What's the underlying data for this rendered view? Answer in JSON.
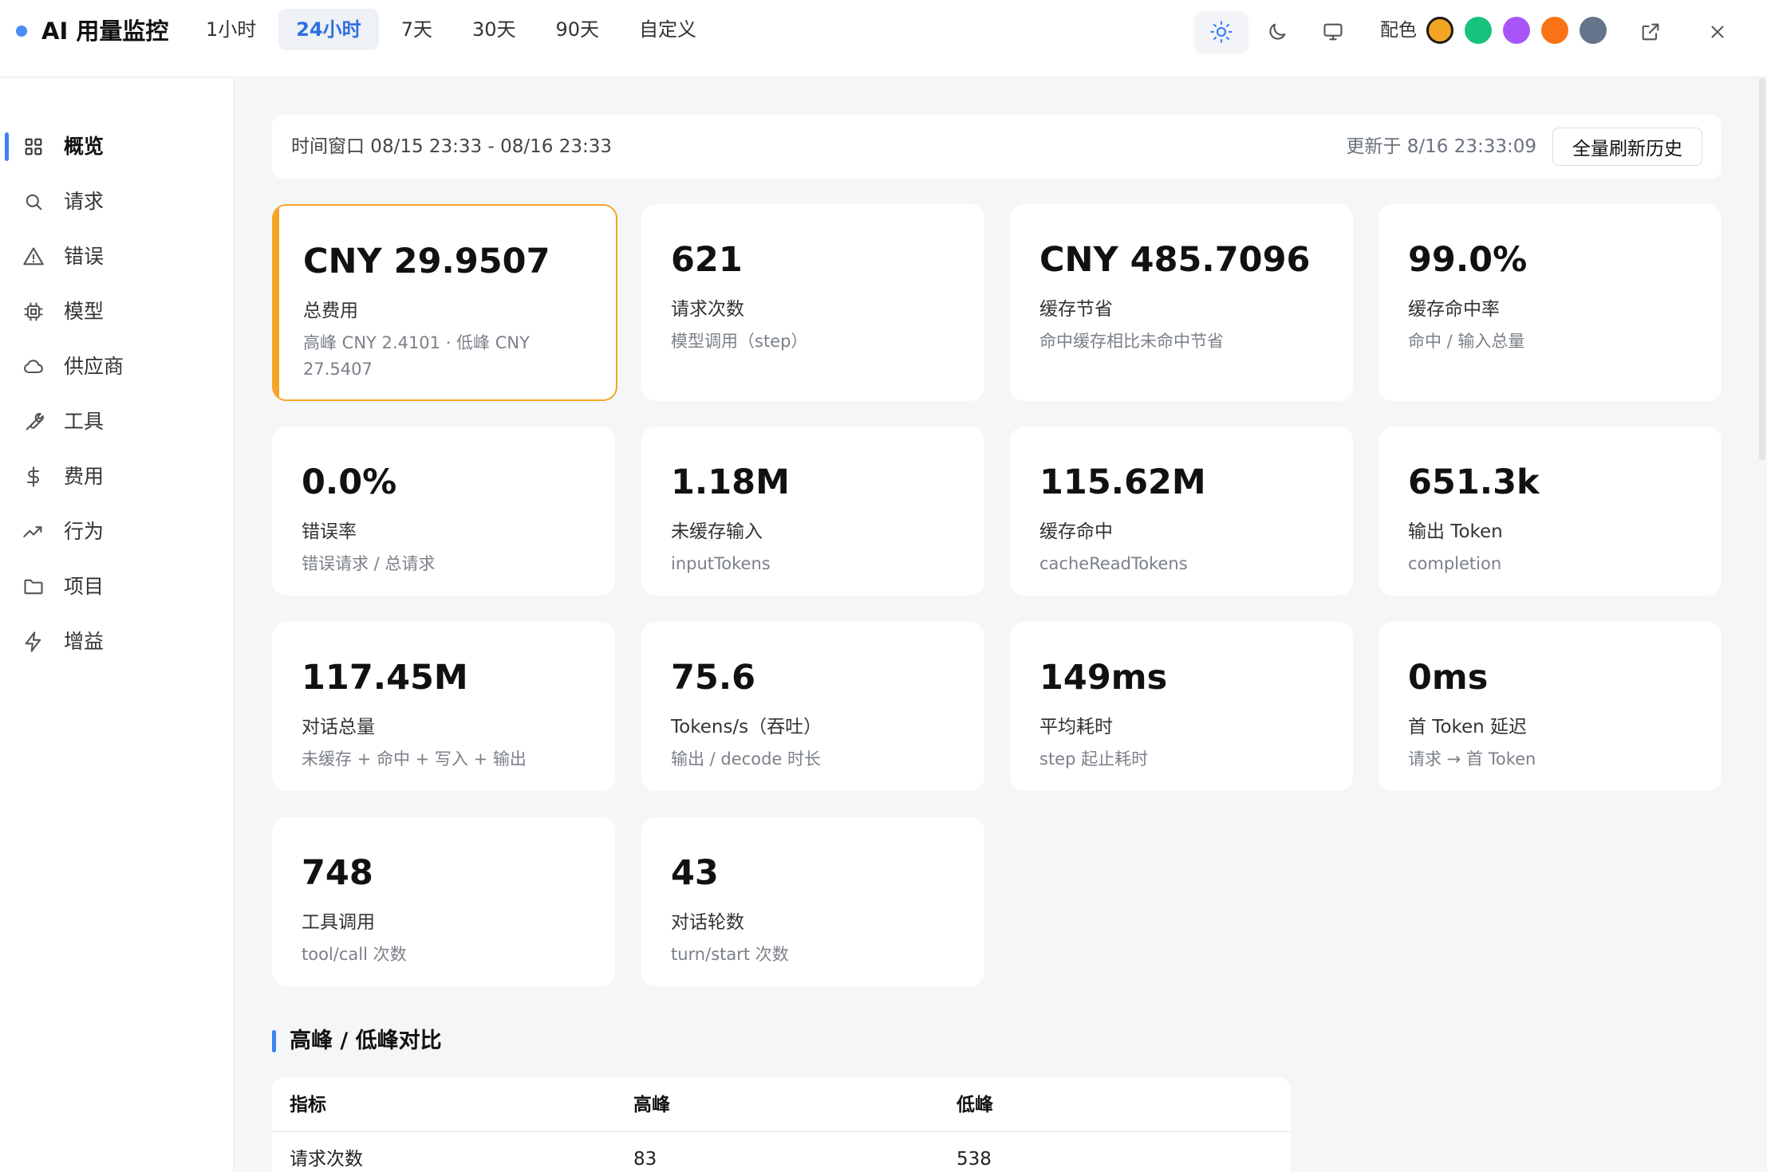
{
  "app": {
    "title": "AI 用量监控"
  },
  "range_tabs": [
    {
      "label": "1小时",
      "active": false
    },
    {
      "label": "24小时",
      "active": true
    },
    {
      "label": "7天",
      "active": false
    },
    {
      "label": "30天",
      "active": false
    },
    {
      "label": "90天",
      "active": false
    },
    {
      "label": "自定义",
      "active": false
    }
  ],
  "toolbar": {
    "theme_icons": [
      "sun-icon",
      "moon-icon",
      "monitor-icon"
    ],
    "palette_label": "配色",
    "palette_colors": [
      "#f5a524",
      "#17c27f",
      "#a855f7",
      "#f97316",
      "#64748b"
    ],
    "selected_palette": 0,
    "open_external_icon": "external-link-icon",
    "close_icon": "close-icon"
  },
  "sidebar": {
    "items": [
      {
        "label": "概览",
        "icon": "grid-icon",
        "active": true
      },
      {
        "label": "请求",
        "icon": "search-icon",
        "active": false
      },
      {
        "label": "错误",
        "icon": "warning-icon",
        "active": false
      },
      {
        "label": "模型",
        "icon": "chip-icon",
        "active": false
      },
      {
        "label": "供应商",
        "icon": "cloud-icon",
        "active": false
      },
      {
        "label": "工具",
        "icon": "wrench-icon",
        "active": false
      },
      {
        "label": "费用",
        "icon": "dollar-icon",
        "active": false
      },
      {
        "label": "行为",
        "icon": "trend-icon",
        "active": false
      },
      {
        "label": "项目",
        "icon": "folder-icon",
        "active": false
      },
      {
        "label": "增益",
        "icon": "bolt-icon",
        "active": false
      }
    ]
  },
  "window_bar": {
    "window_text": "时间窗口 08/15 23:33 - 08/16 23:33",
    "updated_text": "更新于 8/16 23:33:09",
    "refresh_label": "全量刷新历史"
  },
  "cards": [
    {
      "value": "CNY 29.9507",
      "title": "总费用",
      "sub": "高峰 CNY 2.4101 · 低峰 CNY 27.5407",
      "highlight": true
    },
    {
      "value": "621",
      "title": "请求次数",
      "sub": "模型调用（step）"
    },
    {
      "value": "CNY 485.7096",
      "title": "缓存节省",
      "sub": "命中缓存相比未命中节省"
    },
    {
      "value": "99.0%",
      "title": "缓存命中率",
      "sub": "命中 / 输入总量"
    },
    {
      "value": "0.0%",
      "title": "错误率",
      "sub": "错误请求 / 总请求"
    },
    {
      "value": "1.18M",
      "title": "未缓存输入",
      "sub": "inputTokens"
    },
    {
      "value": "115.62M",
      "title": "缓存命中",
      "sub": "cacheReadTokens"
    },
    {
      "value": "651.3k",
      "title": "输出 Token",
      "sub": "completion"
    },
    {
      "value": "117.45M",
      "title": "对话总量",
      "sub": "未缓存 + 命中 + 写入 + 输出"
    },
    {
      "value": "75.6",
      "title": "Tokens/s（吞吐）",
      "sub": "输出 / decode 时长"
    },
    {
      "value": "149ms",
      "title": "平均耗时",
      "sub": "step 起止耗时"
    },
    {
      "value": "0ms",
      "title": "首 Token 延迟",
      "sub": "请求 → 首 Token"
    },
    {
      "value": "748",
      "title": "工具调用",
      "sub": "tool/call 次数"
    },
    {
      "value": "43",
      "title": "对话轮数",
      "sub": "turn/start 次数"
    }
  ],
  "peak_section": {
    "title": "高峰 / 低峰对比",
    "columns": [
      "指标",
      "高峰",
      "低峰"
    ],
    "rows": [
      [
        "请求次数",
        "83",
        "538"
      ]
    ]
  }
}
